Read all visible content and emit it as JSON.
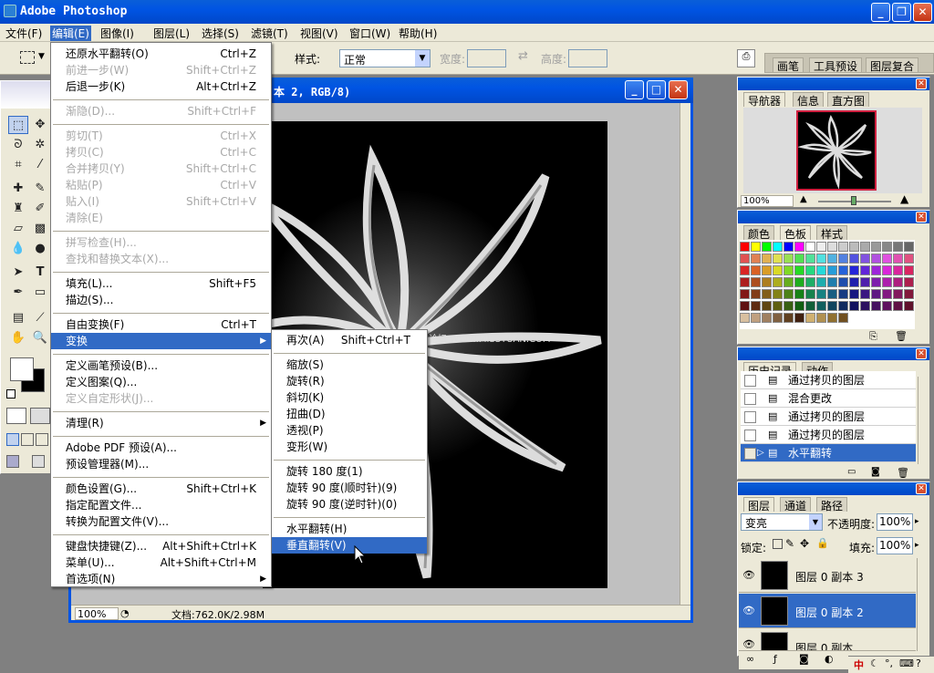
{
  "app": {
    "title": "Adobe Photoshop"
  },
  "menubar": [
    {
      "label": "文件(F)"
    },
    {
      "label": "编辑(E)"
    },
    {
      "label": "图像(I)"
    },
    {
      "label": "图层(L)"
    },
    {
      "label": "选择(S)"
    },
    {
      "label": "滤镜(T)"
    },
    {
      "label": "视图(V)"
    },
    {
      "label": "窗口(W)"
    },
    {
      "label": "帮助(H)"
    }
  ],
  "options": {
    "style_label": "样式:",
    "style_value": "正常",
    "width_label": "宽度:",
    "height_label": "高度:",
    "panel_tabs": [
      "画笔",
      "工具预设",
      "图层复合"
    ]
  },
  "document": {
    "title": "本 2, RGB/8)",
    "zoom": "100%",
    "docsize": "文档:762.0K/2.98M",
    "watermark": "思缘设计论坛  WWW.MISSYUAN.COM"
  },
  "edit_menu": [
    {
      "label": "还原水平翻转(O)",
      "shortcut": "Ctrl+Z",
      "disabled": false
    },
    {
      "label": "前进一步(W)",
      "shortcut": "Shift+Ctrl+Z",
      "disabled": true
    },
    {
      "label": "后退一步(K)",
      "shortcut": "Alt+Ctrl+Z",
      "disabled": false
    },
    {
      "label": "渐隐(D)...",
      "shortcut": "Shift+Ctrl+F",
      "disabled": true
    },
    {
      "label": "剪切(T)",
      "shortcut": "Ctrl+X",
      "disabled": true
    },
    {
      "label": "拷贝(C)",
      "shortcut": "Ctrl+C",
      "disabled": true
    },
    {
      "label": "合并拷贝(Y)",
      "shortcut": "Shift+Ctrl+C",
      "disabled": true
    },
    {
      "label": "粘贴(P)",
      "shortcut": "Ctrl+V",
      "disabled": true
    },
    {
      "label": "贴入(I)",
      "shortcut": "Shift+Ctrl+V",
      "disabled": true
    },
    {
      "label": "清除(E)",
      "shortcut": "",
      "disabled": true
    },
    {
      "label": "拼写检查(H)...",
      "shortcut": "",
      "disabled": true
    },
    {
      "label": "查找和替换文本(X)...",
      "shortcut": "",
      "disabled": true
    },
    {
      "label": "填充(L)...",
      "shortcut": "Shift+F5",
      "disabled": false
    },
    {
      "label": "描边(S)...",
      "shortcut": "",
      "disabled": false
    },
    {
      "label": "自由变换(F)",
      "shortcut": "Ctrl+T",
      "disabled": false
    },
    {
      "label": "变换",
      "shortcut": "",
      "disabled": false
    },
    {
      "label": "定义画笔预设(B)...",
      "shortcut": "",
      "disabled": false
    },
    {
      "label": "定义图案(Q)...",
      "shortcut": "",
      "disabled": false
    },
    {
      "label": "定义自定形状(J)...",
      "shortcut": "",
      "disabled": true
    },
    {
      "label": "清理(R)",
      "shortcut": "",
      "disabled": false
    },
    {
      "label": "Adobe PDF 预设(A)...",
      "shortcut": "",
      "disabled": false
    },
    {
      "label": "预设管理器(M)...",
      "shortcut": "",
      "disabled": false
    },
    {
      "label": "颜色设置(G)...",
      "shortcut": "Shift+Ctrl+K",
      "disabled": false
    },
    {
      "label": "指定配置文件...",
      "shortcut": "",
      "disabled": false
    },
    {
      "label": "转换为配置文件(V)...",
      "shortcut": "",
      "disabled": false
    },
    {
      "label": "键盘快捷键(Z)...",
      "shortcut": "Alt+Shift+Ctrl+K",
      "disabled": false
    },
    {
      "label": "菜单(U)...",
      "shortcut": "Alt+Shift+Ctrl+M",
      "disabled": false
    },
    {
      "label": "首选项(N)",
      "shortcut": "",
      "disabled": false
    }
  ],
  "transform_menu": [
    {
      "label": "再次(A)",
      "shortcut": "Shift+Ctrl+T"
    },
    {
      "label": "缩放(S)",
      "shortcut": ""
    },
    {
      "label": "旋转(R)",
      "shortcut": ""
    },
    {
      "label": "斜切(K)",
      "shortcut": ""
    },
    {
      "label": "扭曲(D)",
      "shortcut": ""
    },
    {
      "label": "透视(P)",
      "shortcut": ""
    },
    {
      "label": "变形(W)",
      "shortcut": ""
    },
    {
      "label": "旋转 180 度(1)",
      "shortcut": ""
    },
    {
      "label": "旋转 90 度(顺时针)(9)",
      "shortcut": ""
    },
    {
      "label": "旋转 90 度(逆时针)(0)",
      "shortcut": ""
    },
    {
      "label": "水平翻转(H)",
      "shortcut": ""
    },
    {
      "label": "垂直翻转(V)",
      "shortcut": ""
    }
  ],
  "navigator": {
    "tabs": [
      "导航器",
      "信息",
      "直方图"
    ],
    "zoom": "100%"
  },
  "swatches_panel": {
    "tabs": [
      "颜色",
      "色板",
      "样式"
    ]
  },
  "history": {
    "tabs": [
      "历史记录",
      "动作"
    ],
    "items": [
      "通过拷贝的图层",
      "混合更改",
      "通过拷贝的图层",
      "通过拷贝的图层",
      "水平翻转"
    ]
  },
  "layers": {
    "tabs": [
      "图层",
      "通道",
      "路径"
    ],
    "blend_mode": "变亮",
    "opacity_label": "不透明度:",
    "opacity": "100%",
    "lock_label": "锁定:",
    "fill_label": "填充:",
    "fill": "100%",
    "items": [
      "图层 0 副本 3",
      "图层 0 副本 2",
      "图层 0 副本"
    ]
  },
  "taskbar": {
    "ime": "中"
  }
}
